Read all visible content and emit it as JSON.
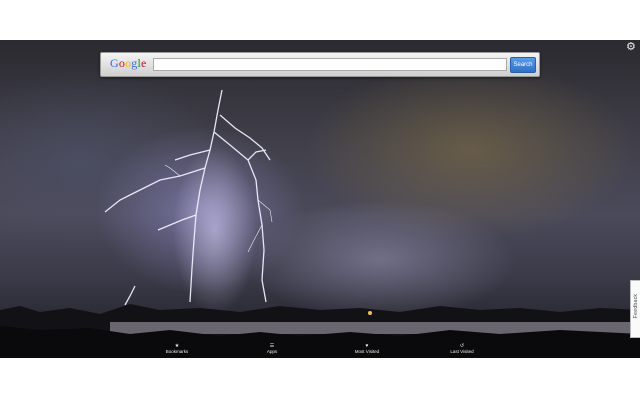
{
  "search": {
    "logo": "Google",
    "placeholder": "",
    "button_label": "Search"
  },
  "settings": {
    "icon": "gear-icon"
  },
  "feedback": {
    "label": "Feedback"
  },
  "bottom_nav": [
    {
      "label": "Bookmarks",
      "icon": "star-icon"
    },
    {
      "label": "Apps",
      "icon": "apps-icon"
    },
    {
      "label": "Most Visited",
      "icon": "heart-icon"
    },
    {
      "label": "Last Visited",
      "icon": "history-icon"
    }
  ],
  "colors": {
    "search_button": "#2f6fc9",
    "logo_blue": "#3369e8",
    "logo_red": "#d50f25",
    "logo_yellow": "#eeb211",
    "logo_green": "#009925"
  }
}
